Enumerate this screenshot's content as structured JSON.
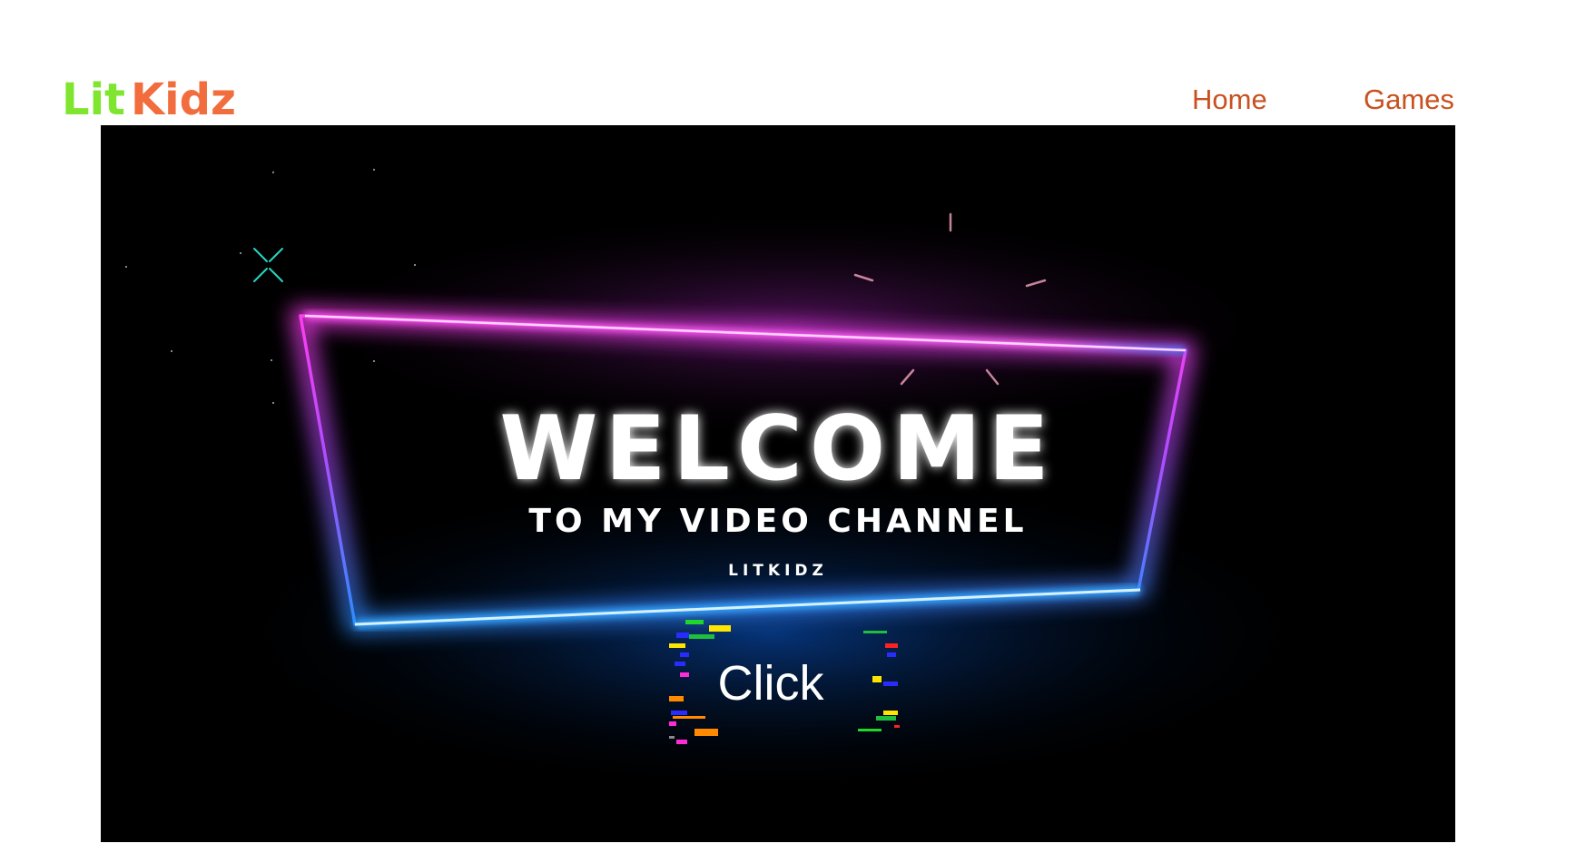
{
  "header": {
    "logo_part1": "Lit",
    "logo_part2": "Kidz",
    "nav": [
      {
        "label": "Home"
      },
      {
        "label": "Games"
      }
    ]
  },
  "video": {
    "headline": "WELCOME",
    "subheadline": "TO MY VIDEO CHANNEL",
    "channel": "LITKIDZ",
    "button_label": "Click"
  },
  "colors": {
    "logo_green": "#7fe52f",
    "logo_orange": "#f26d3d",
    "nav_link": "#c9511f",
    "neon_pink": "#ff3df2",
    "neon_blue": "#2b8cff",
    "video_bg": "#000000"
  },
  "icons": [
    "sparkle-x-icon",
    "burst-rays-icon"
  ]
}
